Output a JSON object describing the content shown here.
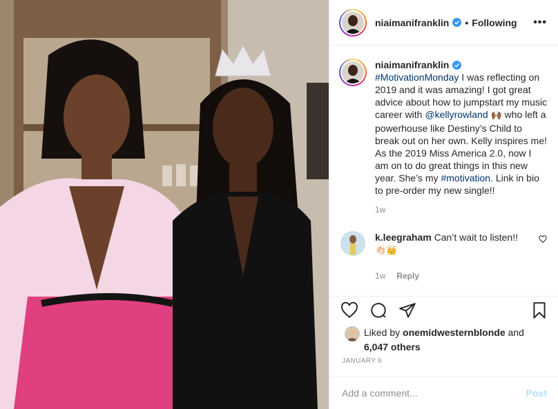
{
  "header": {
    "username": "niaimanifranklin",
    "separator": "•",
    "following_label": "Following",
    "more_label": "•••"
  },
  "caption": {
    "username": "niaimanifranklin",
    "hashtag": "#MotivationMonday",
    "text_1": "I was reflecting on 2019 and it was amazing! I got great advice about how to jumpstart my music career with ",
    "mention": "@kellyrowland",
    "emoji": "🙌🏾",
    "text_2": " who left a powerhouse like Destiny’s Child to break out on her own. Kelly inspires me! As the 2019 Miss America 2.0, now I am on to do great things in this new year. She’s my ",
    "hashtag_2": "#motivation",
    "text_3": ". Link in bio to pre-order my new single!!",
    "time": "1w"
  },
  "comment": {
    "username": "k.leegraham",
    "text": "Can’t wait to listen!!",
    "emoji": "👏🏻👑",
    "time": "1w",
    "reply_label": "Reply"
  },
  "likes": {
    "prefix": "Liked by ",
    "user": "onemidwesternblonde",
    "connector": " and",
    "count": "6,047 others"
  },
  "date": "JANUARY 6",
  "add_comment": {
    "placeholder": "Add a comment...",
    "post_label": "Post"
  },
  "colors": {
    "verified": "#3897f0",
    "link": "#003569",
    "post_button": "#b2dffc"
  }
}
